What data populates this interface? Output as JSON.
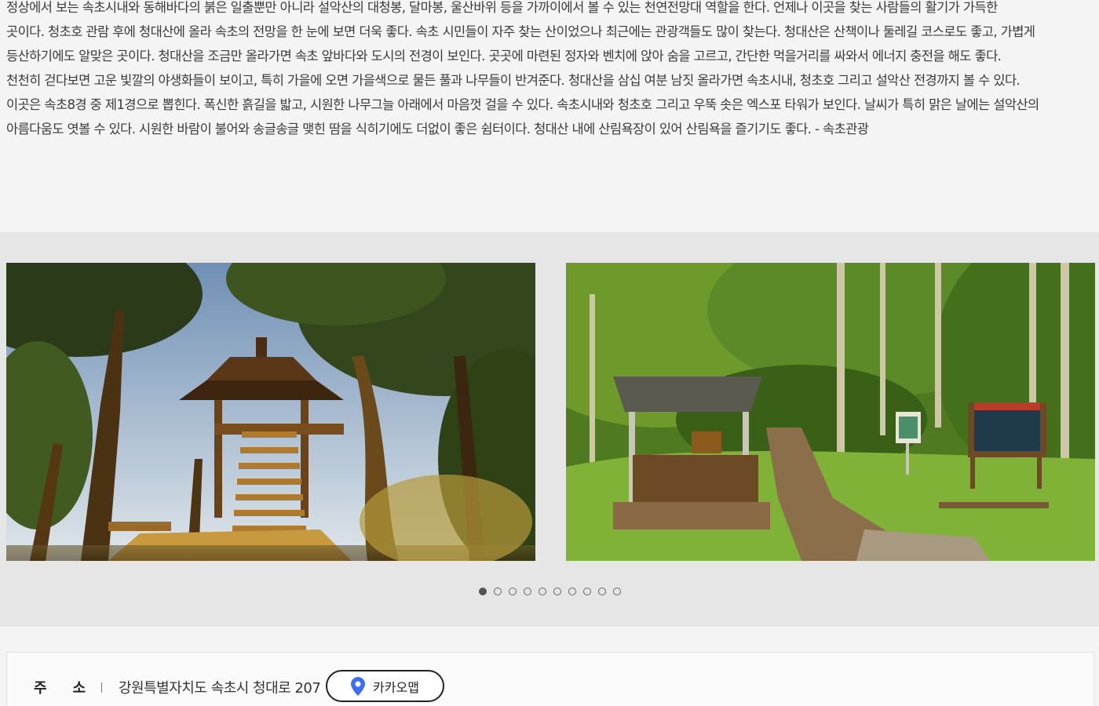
{
  "description": {
    "lines": [
      "정상에서 보는 속초시내와 동해바다의 붉은 일출뿐만 아니라 설악산의 대청봉, 달마봉, 울산바위 등을 가까이에서 볼 수 있는 천연전망대 역할을 한다. 언제나 이곳을 찾는 사람들의 활기가 가득한",
      "곳이다. 청초호 관람 후에 청대산에 올라 속초의 전망을 한 눈에 보면 더욱 좋다. 속초 시민들이 자주 찾는 산이었으나 최근에는 관광객들도 많이 찾는다. 청대산은 산책이나 둘레길 코스로도 좋고, 가볍게",
      "등산하기에도 알맞은 곳이다. 청대산을 조금만 올라가면 속초 앞바다와 도시의 전경이 보인다. 곳곳에 마련된 정자와 벤치에 앉아 숨을 고르고, 간단한 먹을거리를 싸와서 에너지 충전을 해도 좋다.",
      "천천히 걷다보면 고운 빛깔의 야생화들이 보이고, 특히 가을에 오면 가을색으로 물든 풀과 나무들이 반겨준다. 청대산을 삼십 여분 남짓 올라가면 속초시내, 청초호 그리고 설악산 전경까지 볼 수 있다.",
      "이곳은 속초8경 중 제1경으로 뽑힌다. 폭신한 흙길을 밟고, 시원한 나무그늘 아래에서 마음껏 걸을 수 있다. 속초시내와 청초호 그리고 우뚝 솟은 엑스포 타워가 보인다. 날씨가 특히 맑은 날에는 설악산의",
      "아름다움도 엿볼 수 있다. 시원한 바람이 불어와 송글송글 맺힌 땀을 식히기에도 더없이 좋은 쉼터이다. 청대산 내에 산림욕장이 있어 산림욕을 즐기기도 좋다. - 속초관광"
    ]
  },
  "gallery": {
    "slides": [
      {
        "icon": "pavilion-photo"
      },
      {
        "icon": "trail-shelter-photo"
      }
    ],
    "total_pages": 10,
    "current_page": 1,
    "dot_color_active": "#555555"
  },
  "info": {
    "address_label_chars": [
      "주",
      "소"
    ],
    "address_value": "강원특별자치도 속초시 청대로 207",
    "map_button_label": "카카오맵",
    "map_pin_color": "#3b6ff5"
  }
}
